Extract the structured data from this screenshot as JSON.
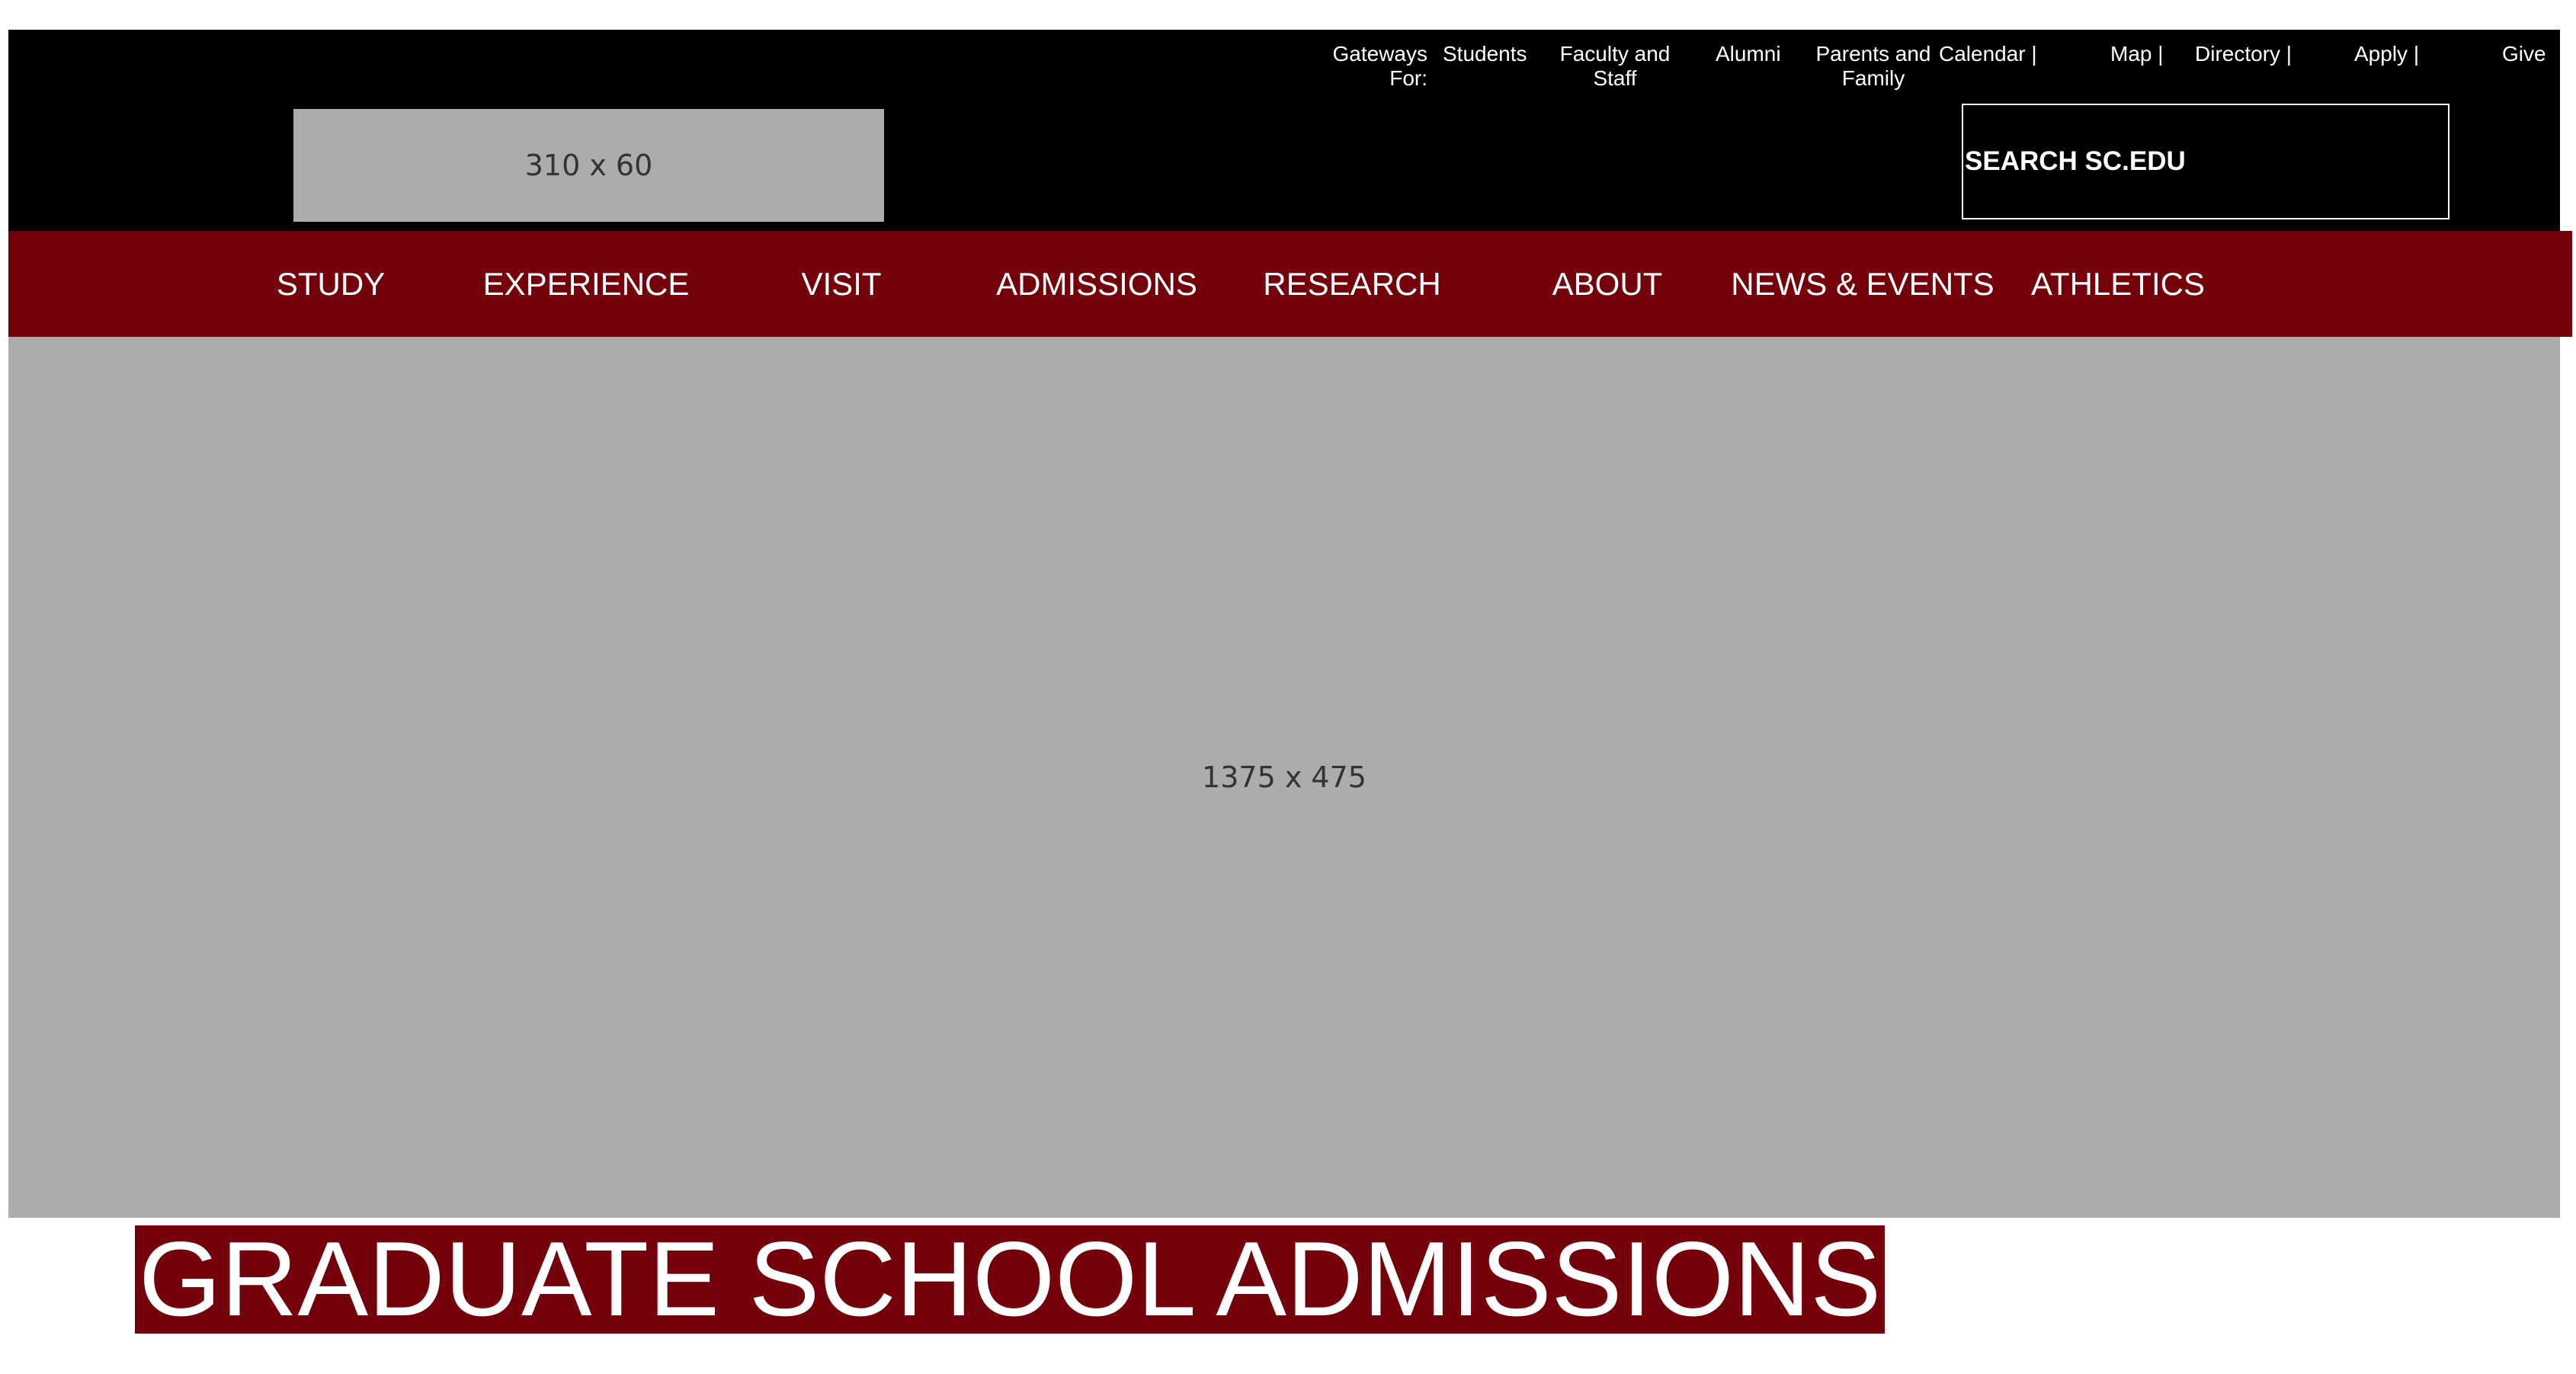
{
  "gateways": {
    "label": "Gateways For:",
    "links": [
      "Students",
      "Faculty and Staff",
      "Alumni",
      "Parents and Family"
    ]
  },
  "utility_links": [
    "Calendar |",
    "Map |",
    "Directory |",
    "Apply |",
    "Give"
  ],
  "logo": {
    "placeholder_text": "310 x 60"
  },
  "search": {
    "placeholder": "SEARCH SC.EDU"
  },
  "main_nav": [
    "STUDY",
    "EXPERIENCE",
    "VISIT",
    "ADMISSIONS",
    "RESEARCH",
    "ABOUT",
    "NEWS & EVENTS",
    "ATHLETICS"
  ],
  "hero": {
    "placeholder_text": "1375 x 475"
  },
  "page": {
    "title": "GRADUATE SCHOOL ADMISSIONS"
  },
  "colors": {
    "header_bg": "#000000",
    "brand_garnet": "#73000a",
    "placeholder_gray": "#acacac"
  }
}
